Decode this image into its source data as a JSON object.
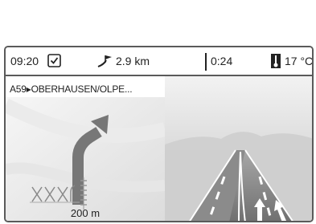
{
  "status": {
    "time": "09:20",
    "distance": "2.9  km",
    "eta": "0:24",
    "temperature": "17 °C"
  },
  "icons": {
    "clock": "clock-check-icon",
    "distance": "flag-route-icon",
    "temperature": "thermometer-icon",
    "turn": "bear-right-arrow-icon"
  },
  "navigation": {
    "road_label": "A59▸OBERHAUSEN/OLPE...",
    "turn_distance": "200 m"
  }
}
